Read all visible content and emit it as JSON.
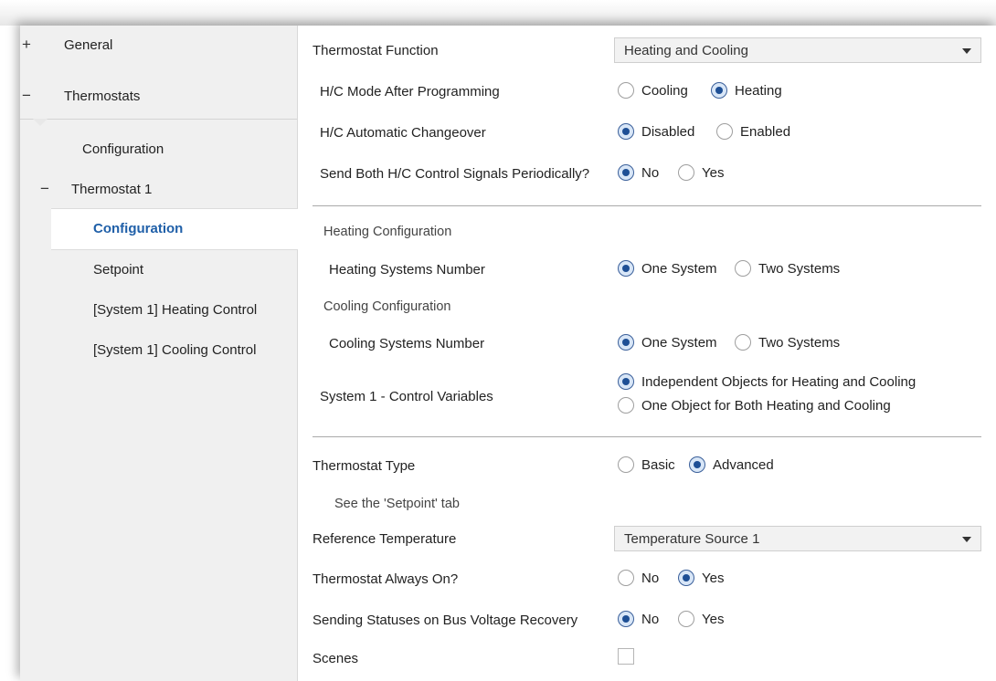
{
  "sidebar": {
    "general": {
      "sign": "+",
      "label": "General"
    },
    "thermostats": {
      "sign": "−",
      "label": "Thermostats"
    },
    "configuration": {
      "label": "Configuration"
    },
    "thermostat1": {
      "sign": "−",
      "label": "Thermostat 1"
    },
    "t1_configuration": {
      "label": "Configuration"
    },
    "setpoint": {
      "label": "Setpoint"
    },
    "heating_control": {
      "label": "[System 1] Heating Control"
    },
    "cooling_control": {
      "label": "[System 1] Cooling Control"
    }
  },
  "content": {
    "thermostat_function": {
      "label": "Thermostat Function",
      "value": "Heating and Cooling"
    },
    "hc_mode": {
      "label": "H/C Mode After Programming",
      "options": [
        "Cooling",
        "Heating"
      ],
      "selected": "Heating"
    },
    "hc_changeover": {
      "label": "H/C Automatic Changeover",
      "options": [
        "Disabled",
        "Enabled"
      ],
      "selected": "Disabled"
    },
    "send_both": {
      "label": "Send Both H/C Control Signals Periodically?",
      "options": [
        "No",
        "Yes"
      ],
      "selected": "No"
    },
    "heating_configuration": {
      "label": "Heating Configuration"
    },
    "heating_systems": {
      "label": "Heating Systems Number",
      "options": [
        "One System",
        "Two Systems"
      ],
      "selected": "One System"
    },
    "cooling_configuration": {
      "label": "Cooling Configuration"
    },
    "cooling_systems": {
      "label": "Cooling Systems Number",
      "options": [
        "One System",
        "Two Systems"
      ],
      "selected": "One System"
    },
    "control_variables": {
      "label": "System 1 - Control Variables",
      "options": [
        "Independent Objects for Heating and Cooling",
        "One Object for Both Heating and Cooling"
      ],
      "selected": "Independent Objects for Heating and Cooling"
    },
    "thermostat_type": {
      "label": "Thermostat Type",
      "options": [
        "Basic",
        "Advanced"
      ],
      "selected": "Advanced"
    },
    "setpoint_note": {
      "label": "See the 'Setpoint' tab"
    },
    "reference_temperature": {
      "label": "Reference Temperature",
      "value": "Temperature Source 1"
    },
    "always_on": {
      "label": "Thermostat Always On?",
      "options": [
        "No",
        "Yes"
      ],
      "selected": "Yes"
    },
    "sending_statuses": {
      "label": "Sending Statuses on Bus Voltage Recovery",
      "options": [
        "No",
        "Yes"
      ],
      "selected": "No"
    },
    "scenes": {
      "label": "Scenes",
      "checked": false
    }
  },
  "colors": {
    "accent": "#1f5fa8",
    "sidebar_bg": "#f0f0f0",
    "radio_dot": "#1e4f95"
  }
}
